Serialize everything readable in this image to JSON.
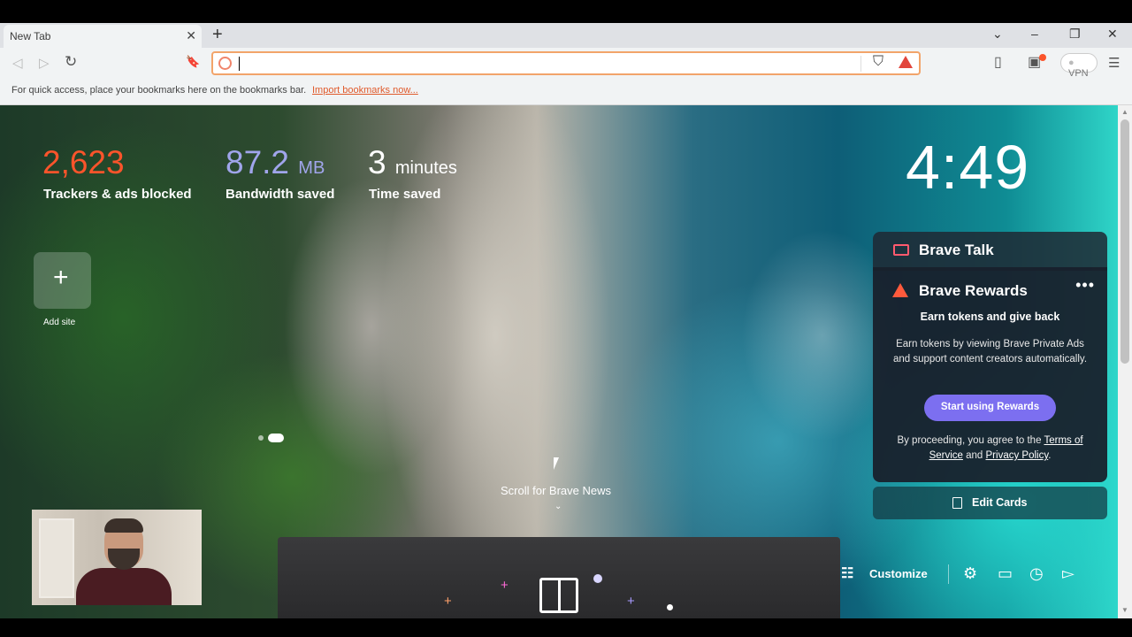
{
  "tab": {
    "title": "New Tab",
    "close": "✕",
    "new": "+"
  },
  "window": {
    "list": "⌄",
    "minimize": "–",
    "restore": "❐",
    "close": "✕"
  },
  "toolbar": {
    "back": "◁",
    "forward": "▷",
    "reload": "↻",
    "bookmark": "🔖",
    "sidebar": "▯",
    "wallet": "▣",
    "vpn_label": "VPN",
    "menu": "☰",
    "url_value": ""
  },
  "bookmarks_bar": {
    "message": "For quick access, place your bookmarks here on the bookmarks bar.",
    "import_link": "Import bookmarks now..."
  },
  "stats": [
    {
      "value": "2,623",
      "unit": "",
      "label": "Trackers & ads blocked",
      "color": "#fb542b"
    },
    {
      "value": "87.2",
      "unit": "MB",
      "label": "Bandwidth saved",
      "color": "#a0a5eb"
    },
    {
      "value": "3",
      "unit": "minutes",
      "label": "Time saved",
      "color": "#ffffff"
    }
  ],
  "clock": "4:49",
  "top_sites": {
    "add_label": "Add site",
    "add_symbol": "+"
  },
  "scroll_prompt": "Scroll for Brave News",
  "widgets": {
    "talk": {
      "label": "Brave Talk"
    },
    "rewards": {
      "title": "Brave Rewards",
      "menu": "•••",
      "headline": "Earn tokens and give back",
      "body": "Earn tokens by viewing Brave Private Ads and support content creators automatically.",
      "button": "Start using Rewards",
      "legal_prefix": "By proceeding, you agree to the",
      "terms": "Terms of Service",
      "and": "and",
      "privacy": "Privacy Policy",
      "period": "."
    },
    "edit_cards": "Edit Cards"
  },
  "bottom_bar": {
    "customize": "Customize",
    "icons": [
      "settings-icon",
      "bookmarks-icon",
      "history-icon",
      "brave-talk-icon"
    ]
  },
  "colors": {
    "accent": "#7c6ff0",
    "brave_orange": "#fb542b"
  }
}
